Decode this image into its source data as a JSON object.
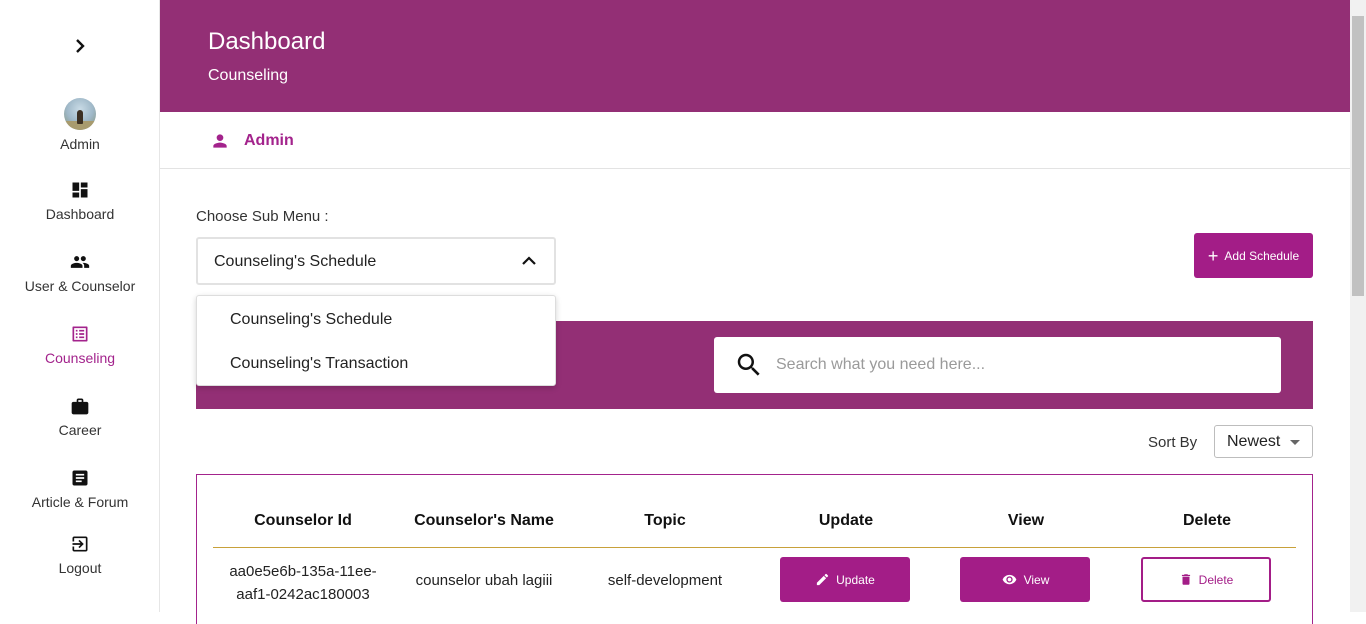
{
  "sidebar": {
    "profile_label": "Admin",
    "items": [
      {
        "label": "Dashboard",
        "icon": "dashboard-icon"
      },
      {
        "label": "User & Counselor",
        "icon": "people-icon"
      },
      {
        "label": "Counseling",
        "icon": "list-alt-icon",
        "active": true
      },
      {
        "label": "Career",
        "icon": "briefcase-icon"
      },
      {
        "label": "Article & Forum",
        "icon": "article-icon"
      },
      {
        "label": "Logout",
        "icon": "logout-icon"
      }
    ]
  },
  "header": {
    "title": "Dashboard",
    "subtitle": "Counseling"
  },
  "userbar": {
    "name": "Admin"
  },
  "submenu": {
    "label": "Choose Sub Menu :",
    "selected": "Counseling's Schedule",
    "options": [
      "Counseling's Schedule",
      "Counseling's Transaction"
    ]
  },
  "add_button_label": "Add Schedule",
  "search": {
    "placeholder": "Search what you need here..."
  },
  "sort": {
    "label": "Sort By",
    "selected": "Newest"
  },
  "table": {
    "columns": [
      "Counselor Id",
      "Counselor's Name",
      "Topic",
      "Update",
      "View",
      "Delete"
    ],
    "rows": [
      {
        "id_line1": "aa0e5e6b-135a-11ee-",
        "id_line2": "aaf1-0242ac180003",
        "name": "counselor ubah lagiii",
        "topic": "self-development",
        "update_label": "Update",
        "view_label": "View",
        "delete_label": "Delete"
      }
    ]
  },
  "colors": {
    "primary": "#932f75",
    "accent": "#a31d87",
    "header_divider": "#c8a13a"
  }
}
